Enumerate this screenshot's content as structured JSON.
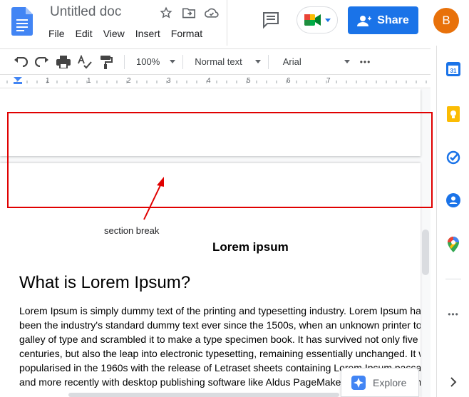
{
  "header": {
    "title": "Untitled doc",
    "menu": [
      "File",
      "Edit",
      "View",
      "Insert",
      "Format"
    ],
    "share_label": "Share",
    "avatar_letter": "B"
  },
  "toolbar": {
    "zoom": "100%",
    "style": "Normal text",
    "font": "Arial",
    "more": "•••"
  },
  "ruler": {
    "numbers": [
      "1",
      "1",
      "2",
      "3",
      "4",
      "5",
      "6",
      "7"
    ]
  },
  "document": {
    "annotation": "section break",
    "lorem_title": "Lorem ipsum",
    "heading": "What is Lorem Ipsum?",
    "lines": [
      "Lorem Ipsum is simply dummy text of the printing and typesetting industry. Lorem Ipsum has",
      "been the industry's standard dummy text ever since the 1500s, when an unknown printer took a",
      "galley of type and scrambled it to make a type specimen book. It has survived not only five",
      "centuries, but also the leap into electronic typesetting, remaining essentially unchanged. It was",
      "popularised in the 1960s with the release of Letraset sheets containing Lorem Ipsum passages,",
      "and more recently with desktop publishing software like Aldus PageMaker including versions"
    ]
  },
  "explore": {
    "label": "Explore"
  },
  "colors": {
    "share": "#1a73e8",
    "avatar": "#e8710a",
    "highlight_box": "#e00000"
  }
}
